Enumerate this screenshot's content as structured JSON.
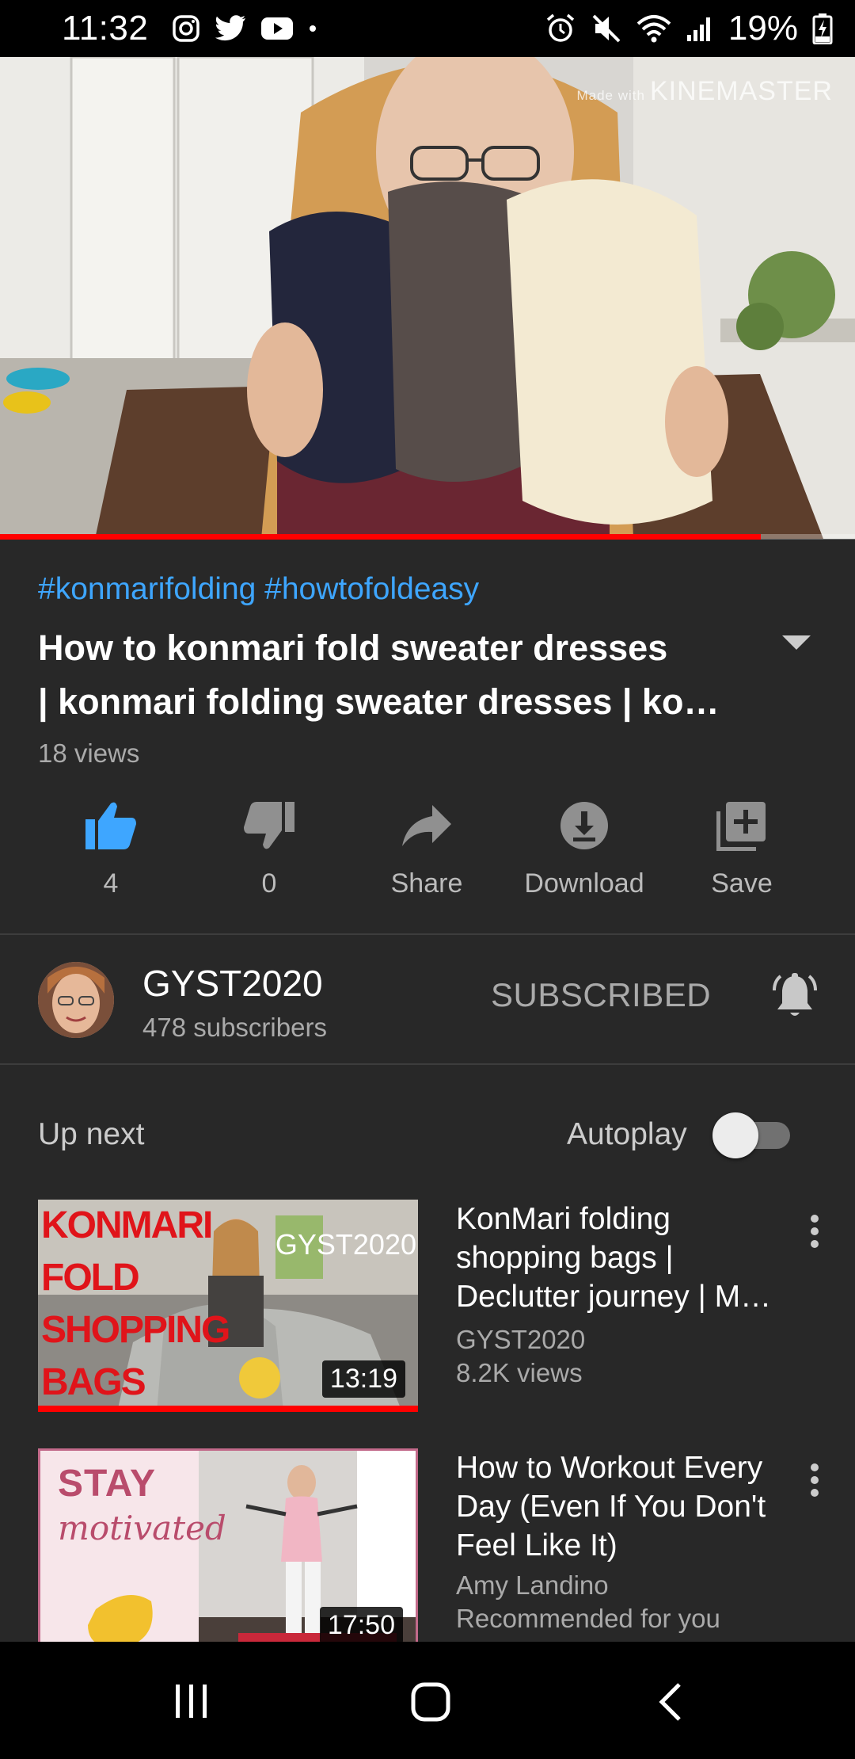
{
  "status_bar": {
    "time": "11:32",
    "battery": "19%",
    "left_icons": [
      "instagram-icon",
      "twitter-icon",
      "youtube-icon",
      "dot-icon"
    ],
    "right_icons": [
      "alarm-icon",
      "mute-icon",
      "wifi-icon",
      "signal-icon",
      "battery-charging-icon"
    ]
  },
  "video": {
    "watermark_small": "Made with",
    "watermark_brand": "KINEMASTER",
    "progress": 0.89,
    "progress_color": "#ff0000"
  },
  "info": {
    "hashtags": "#konmarifolding #howtofoldeasy",
    "title_line1": "How to konmari fold sweater dresses",
    "title_line2": "| konmari folding sweater dresses | ko…",
    "views": "18 views"
  },
  "actions": {
    "like": "4",
    "dislike": "0",
    "share": "Share",
    "download": "Download",
    "save": "Save"
  },
  "channel": {
    "name": "GYST2020",
    "subscribers": "478 subscribers",
    "subscribe_state": "SUBSCRIBED"
  },
  "up_next": {
    "label": "Up next",
    "autoplay_label": "Autoplay",
    "autoplay_on": false
  },
  "recommendations": [
    {
      "title_line1": "KonMari folding",
      "title_line2": "shopping bags |",
      "title_line3": "Declutter journey | M…",
      "channel": "GYST2020",
      "views": "8.2K views",
      "duration": "13:19",
      "thumb_text": [
        "KONMARI",
        "FOLD",
        "SHOPPING",
        "BAGS"
      ],
      "thumb_brand": "GYST2020",
      "watched": 1.0
    },
    {
      "title_line1": "How to Workout Every",
      "title_line2": "Day (Even If You Don't",
      "title_line3": "Feel Like It)",
      "channel": "Amy Landino",
      "views": "Recommended for you",
      "duration": "17:50",
      "thumb_text": [
        "STAY",
        "motivated"
      ]
    }
  ],
  "colors": {
    "accent_blue": "#3ea6ff",
    "background": "#282828",
    "youtube_red": "#ff0000"
  }
}
